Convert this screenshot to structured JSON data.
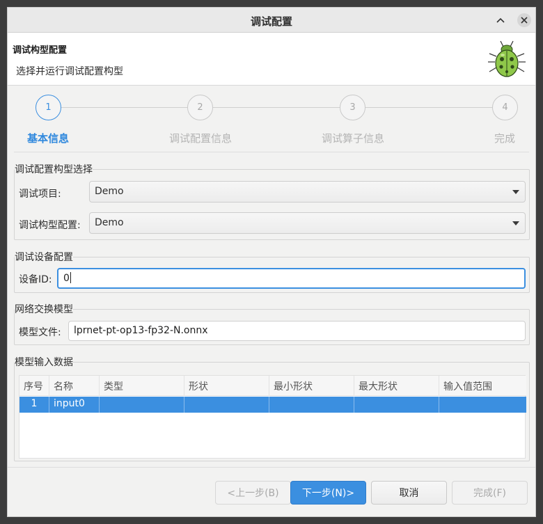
{
  "window": {
    "title": "调试配置"
  },
  "header": {
    "title": "调试构型配置",
    "subtitle": "选择并运行调试配置构型"
  },
  "steps": [
    {
      "number": "1",
      "label": "基本信息"
    },
    {
      "number": "2",
      "label": "调试配置信息"
    },
    {
      "number": "3",
      "label": "调试算子信息"
    },
    {
      "number": "4",
      "label": "完成"
    }
  ],
  "config_group": {
    "title": "调试配置构型选择",
    "project_label": "调试项目:",
    "project_value": "Demo",
    "profile_label": "调试构型配置:",
    "profile_value": "Demo"
  },
  "device_group": {
    "title": "调试设备配置",
    "device_label": "设备ID:",
    "device_value": "0"
  },
  "model_group": {
    "title": "网络交换模型",
    "file_label": "模型文件:",
    "file_value": "lprnet-pt-op13-fp32-N.onnx"
  },
  "input_group": {
    "title": "模型输入数据",
    "columns": [
      "序号",
      "名称",
      "类型",
      "形状",
      "最小形状",
      "最大形状",
      "输入值范围"
    ],
    "rows": [
      {
        "index": "1",
        "name": "input0"
      }
    ]
  },
  "buttons": {
    "prev": "<上一步(B)",
    "next": "下一步(N)>",
    "cancel": "取消",
    "finish": "完成(F)"
  },
  "colors": {
    "accent": "#3b8fe0"
  }
}
